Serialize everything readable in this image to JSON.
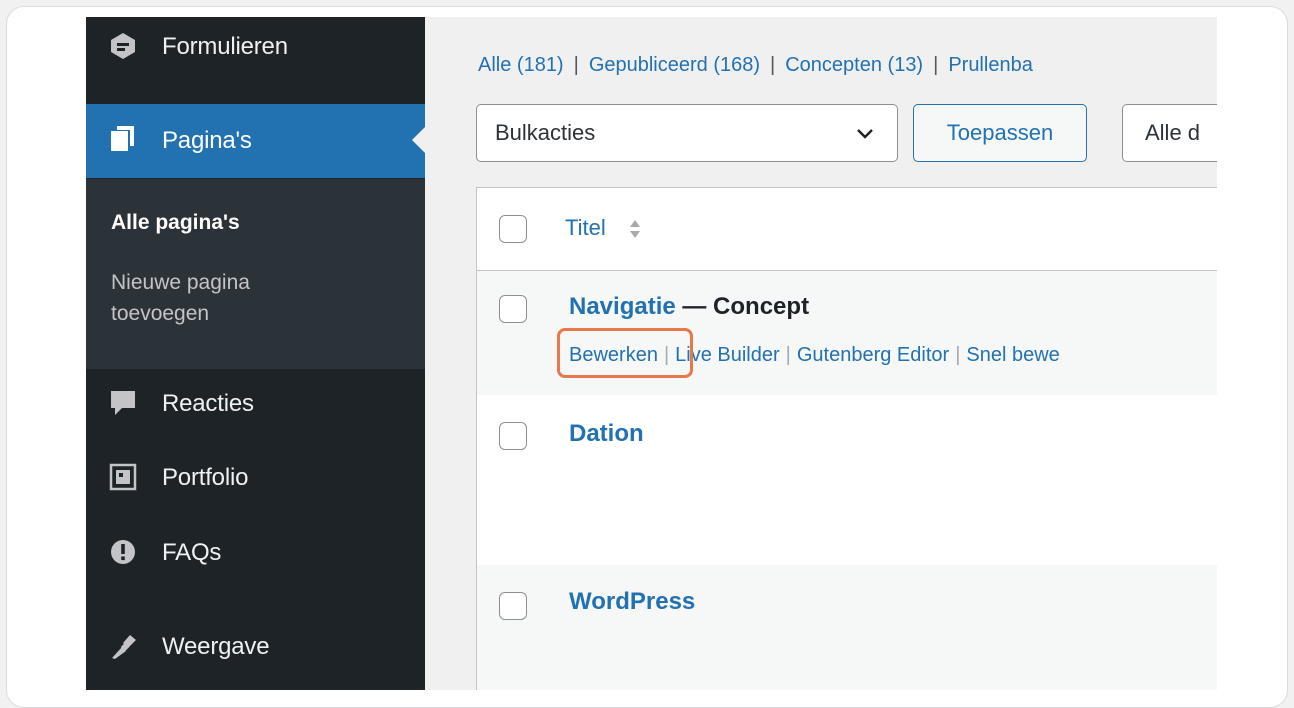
{
  "sidebar": {
    "items": [
      {
        "label": "Formulieren",
        "icon": "forms-icon"
      },
      {
        "label": "Pagina's",
        "icon": "pages-icon"
      },
      {
        "label": "Reacties",
        "icon": "comment-icon"
      },
      {
        "label": "Portfolio",
        "icon": "portfolio-icon"
      },
      {
        "label": "FAQs",
        "icon": "faq-icon"
      },
      {
        "label": "Weergave",
        "icon": "appearance-icon"
      }
    ],
    "submenu": [
      {
        "label": "Alle pagina's"
      },
      {
        "label_line1": "Nieuwe pagina",
        "label_line2": "toevoegen"
      }
    ]
  },
  "views": {
    "all": "Alle (181)",
    "published": "Gepubliceerd (168)",
    "drafts": "Concepten (13)",
    "trash": "Prullenba",
    "separator": "|"
  },
  "bulk": {
    "select_value": "Bulkacties",
    "apply_label": "Toepassen",
    "dates_value": "Alle d"
  },
  "table": {
    "header": {
      "title": "Titel"
    },
    "rows": [
      {
        "title": "Navigatie",
        "state": " — Concept"
      },
      {
        "title": "Dation"
      },
      {
        "title": "WordPress"
      }
    ],
    "row_actions": {
      "edit": "Bewerken",
      "live_builder": "Live Builder",
      "gutenberg": "Gutenberg Editor",
      "quick_edit": "Snel bewe",
      "separator": "|"
    }
  },
  "colors": {
    "accent": "#2271b1",
    "sidebar_bg": "#1d2327",
    "submenu_bg": "#2c3338",
    "highlight": "#e8784b"
  }
}
